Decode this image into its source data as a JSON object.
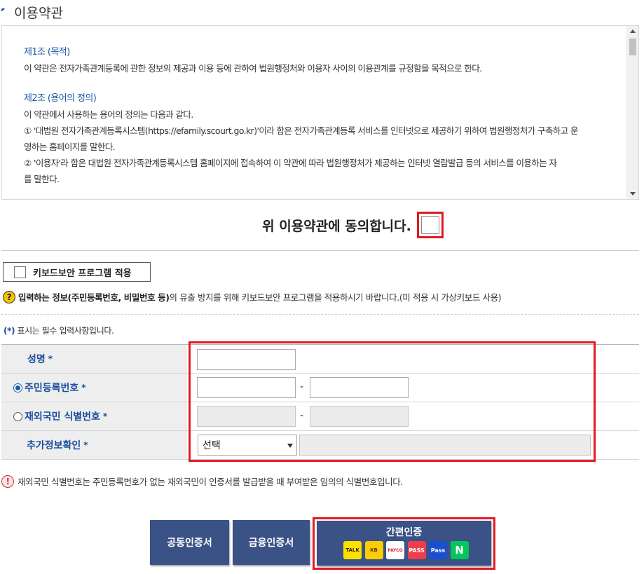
{
  "section": {
    "title": "이용약관"
  },
  "terms": {
    "art1_title": "제1조 (목적)",
    "art1_body": "이 약관은 전자가족관계등록에 관한 정보의 제공과 이용 등에 관하여 법원행정처와 이용자 사이의 이용관계를 규정함을 목적으로 한다.",
    "art2_title": "제2조 (용어의 정의)",
    "art2_intro": "이 약관에서 사용하는 용어의 정의는 다음과 같다.",
    "art2_item1a": "① '대법원 전자가족관계등록시스템(https://efamily.scourt.go.kr)'이라 함은 전자가족관계등록 서비스를 인터넷으로 제공하기 위하여 법원행정처가 구축하고 운",
    "art2_item1b": "영하는 홈페이지를 말한다.",
    "art2_item2a": "② '이용자'라 함은 대법원 전자가족관계등록시스템 홈페이지에 접속하여 이 약관에 따라 법원행정처가 제공하는 인터넷 열람발급 등의 서비스를 이용하는 자",
    "art2_item2b": "를 말한다."
  },
  "agree": {
    "label": "위 이용약관에 동의합니다."
  },
  "keyboard_security": {
    "button_label": "키보드보안 프로그램 적용",
    "notice_prefix": "입력하는 정보(주민등록번호, 비밀번호 등)",
    "notice_suffix": "의 유출 방지를 위해 키보드보안 프로그램을 적용하시기 바랍니다.(미 적용 시 가상키보드 사용)"
  },
  "required_note": {
    "star": "(*)",
    "text": " 표시는 필수 입력사항입니다."
  },
  "form": {
    "name_label": "성명",
    "rrn_label": "주민등록번호",
    "foreign_label": "재외국민 식별번호",
    "extra_label": "추가정보확인",
    "required_mark": "*",
    "dash": "-",
    "select_value": "선택",
    "selected_id_type": "주민등록번호"
  },
  "warn_note": {
    "text": "재외국민 식별번호는 주민등록번호가 없는 재외국민이 인증서를 발급받을 때 부여받은 임의의 식별번호입니다."
  },
  "buttons": {
    "joint_cert": "공동인증서",
    "finance_cert": "금융인증서",
    "easy_auth": "간편인증",
    "easy_providers": [
      "TALK",
      "KB",
      "PAYCO",
      "PASS",
      "Pass",
      "N"
    ]
  },
  "colors": {
    "accent_blue": "#1a5aa6",
    "button_navy": "#3a5285",
    "highlight_red": "#e21b23"
  }
}
